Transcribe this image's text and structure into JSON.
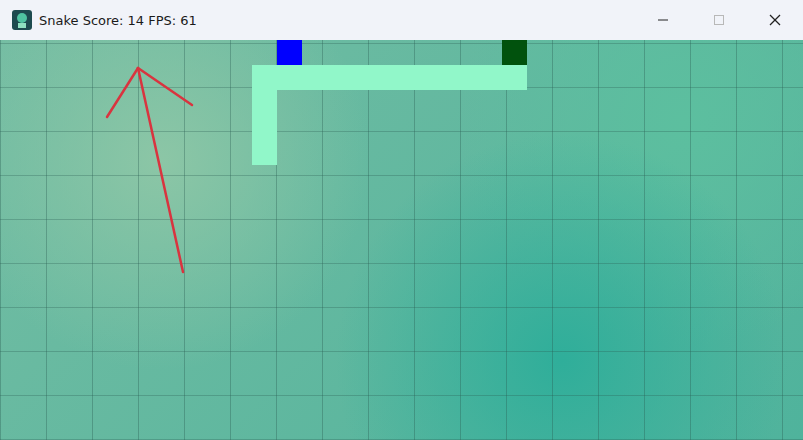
{
  "window": {
    "title": "Snake Score: 14 FPS: 61",
    "controls": [
      {
        "name": "minimize",
        "disabled": false
      },
      {
        "name": "maximize",
        "disabled": true
      },
      {
        "name": "close",
        "disabled": false
      }
    ]
  },
  "board": {
    "columns": 32,
    "rows": 16,
    "snake": [
      {
        "col": 20,
        "row": 0,
        "head": true
      },
      {
        "col": 20,
        "row": 1,
        "head": false
      },
      {
        "col": 19,
        "row": 1,
        "head": false
      },
      {
        "col": 18,
        "row": 1,
        "head": false
      },
      {
        "col": 17,
        "row": 1,
        "head": false
      },
      {
        "col": 16,
        "row": 1,
        "head": false
      },
      {
        "col": 15,
        "row": 1,
        "head": false
      },
      {
        "col": 14,
        "row": 1,
        "head": false
      },
      {
        "col": 13,
        "row": 1,
        "head": false
      },
      {
        "col": 12,
        "row": 1,
        "head": false
      },
      {
        "col": 11,
        "row": 1,
        "head": false
      },
      {
        "col": 10,
        "row": 1,
        "head": false
      },
      {
        "col": 10,
        "row": 2,
        "head": false
      },
      {
        "col": 10,
        "row": 3,
        "head": false
      },
      {
        "col": 10,
        "row": 4,
        "head": false
      }
    ],
    "food": {
      "col": 11,
      "row": 0
    }
  }
}
